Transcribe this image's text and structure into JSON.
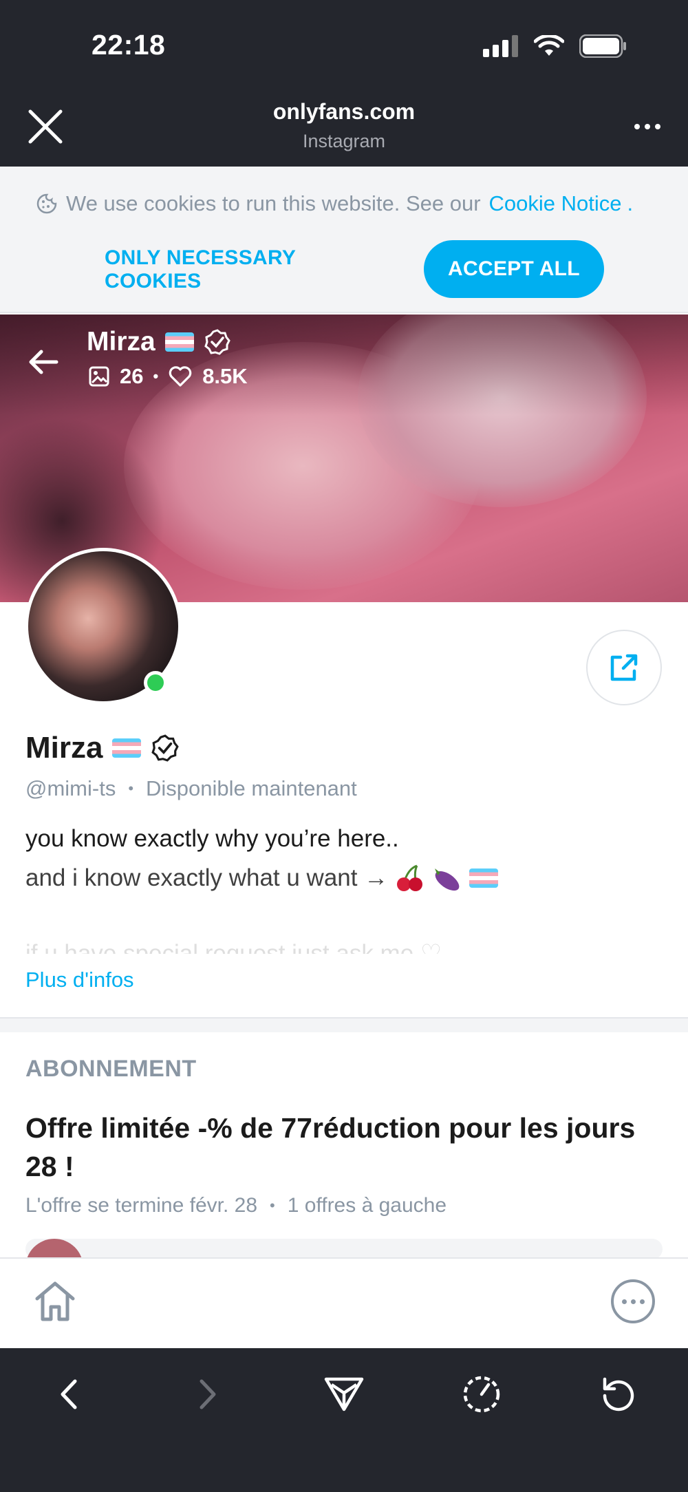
{
  "status_bar": {
    "time": "22:18"
  },
  "browser": {
    "url": "onlyfans.com",
    "source": "Instagram"
  },
  "cookie_banner": {
    "text": "We use cookies to run this website. See our",
    "link": "Cookie Notice",
    "period": ".",
    "necessary_label": "ONLY NECESSARY COOKIES",
    "accept_label": "ACCEPT ALL"
  },
  "cover": {
    "name": "Mirza",
    "media_count": "26",
    "likes": "8.5K"
  },
  "profile": {
    "name": "Mirza",
    "handle": "@mimi-ts",
    "separator": "•",
    "status": "Disponible maintenant",
    "bio_line1": "you know exactly why you’re here..",
    "bio_line2": "and i know exactly what u want →",
    "bio_line3": "if u have special request just ask me ♡",
    "more_info": "Plus d'infos"
  },
  "subscription": {
    "label": "ABONNEMENT",
    "offer_title": "Offre limitée -% de 77réduction pour les jours 28 !",
    "offer_end": "L'offre se termine févr. 28",
    "offer_separator": "•",
    "offers_left": "1 offres à gauche"
  },
  "colors": {
    "accent": "#00aff0",
    "dark_bar": "#24262d",
    "online": "#2ecc55"
  }
}
